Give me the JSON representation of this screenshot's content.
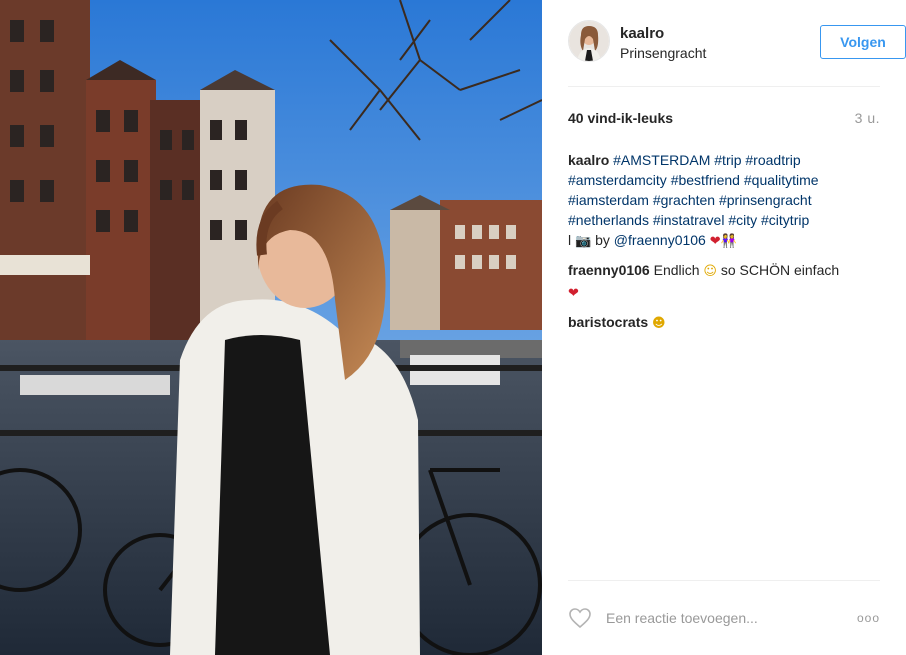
{
  "post": {
    "username": "kaalro",
    "location": "Prinsengracht",
    "follow_label": "Volgen",
    "likes": "40 vind-ik-leuks",
    "time": "3 u."
  },
  "caption": {
    "user": "kaalro",
    "tags_line1": [
      "#AMSTERDAM",
      "#trip",
      "#roadtrip"
    ],
    "tags_line2": [
      "#amsterdamcity",
      "#bestfriend",
      "#qualitytime"
    ],
    "tags_line3": [
      "#iamsterdam",
      "#grachten",
      "#prinsengracht"
    ],
    "tags_line4": [
      "#netherlands",
      "#instatravel",
      "#city",
      "#citytrip"
    ],
    "line5_prefix": "l",
    "line5_by": "by",
    "mention": "@fraenny0106"
  },
  "comments": [
    {
      "user": "fraenny0106",
      "text_a": "Endlich",
      "text_b": "so SCHÖN einfach"
    },
    {
      "user": "baristocrats"
    }
  ],
  "footer": {
    "add_comment_placeholder": "Een reactie toevoegen...",
    "more_label": "ooo"
  },
  "icons": {
    "like": "heart-outline-icon",
    "more": "more-options-icon",
    "camera": "camera-emoji",
    "hearts": "hearts-emoji",
    "couple": "couple-emoji",
    "grin": "grinning-emoji",
    "tongue": "tongue-out-emoji"
  },
  "colors": {
    "accent": "#3897f0",
    "hashtag": "#003569",
    "muted": "#999999",
    "heart": "#d1202f"
  }
}
